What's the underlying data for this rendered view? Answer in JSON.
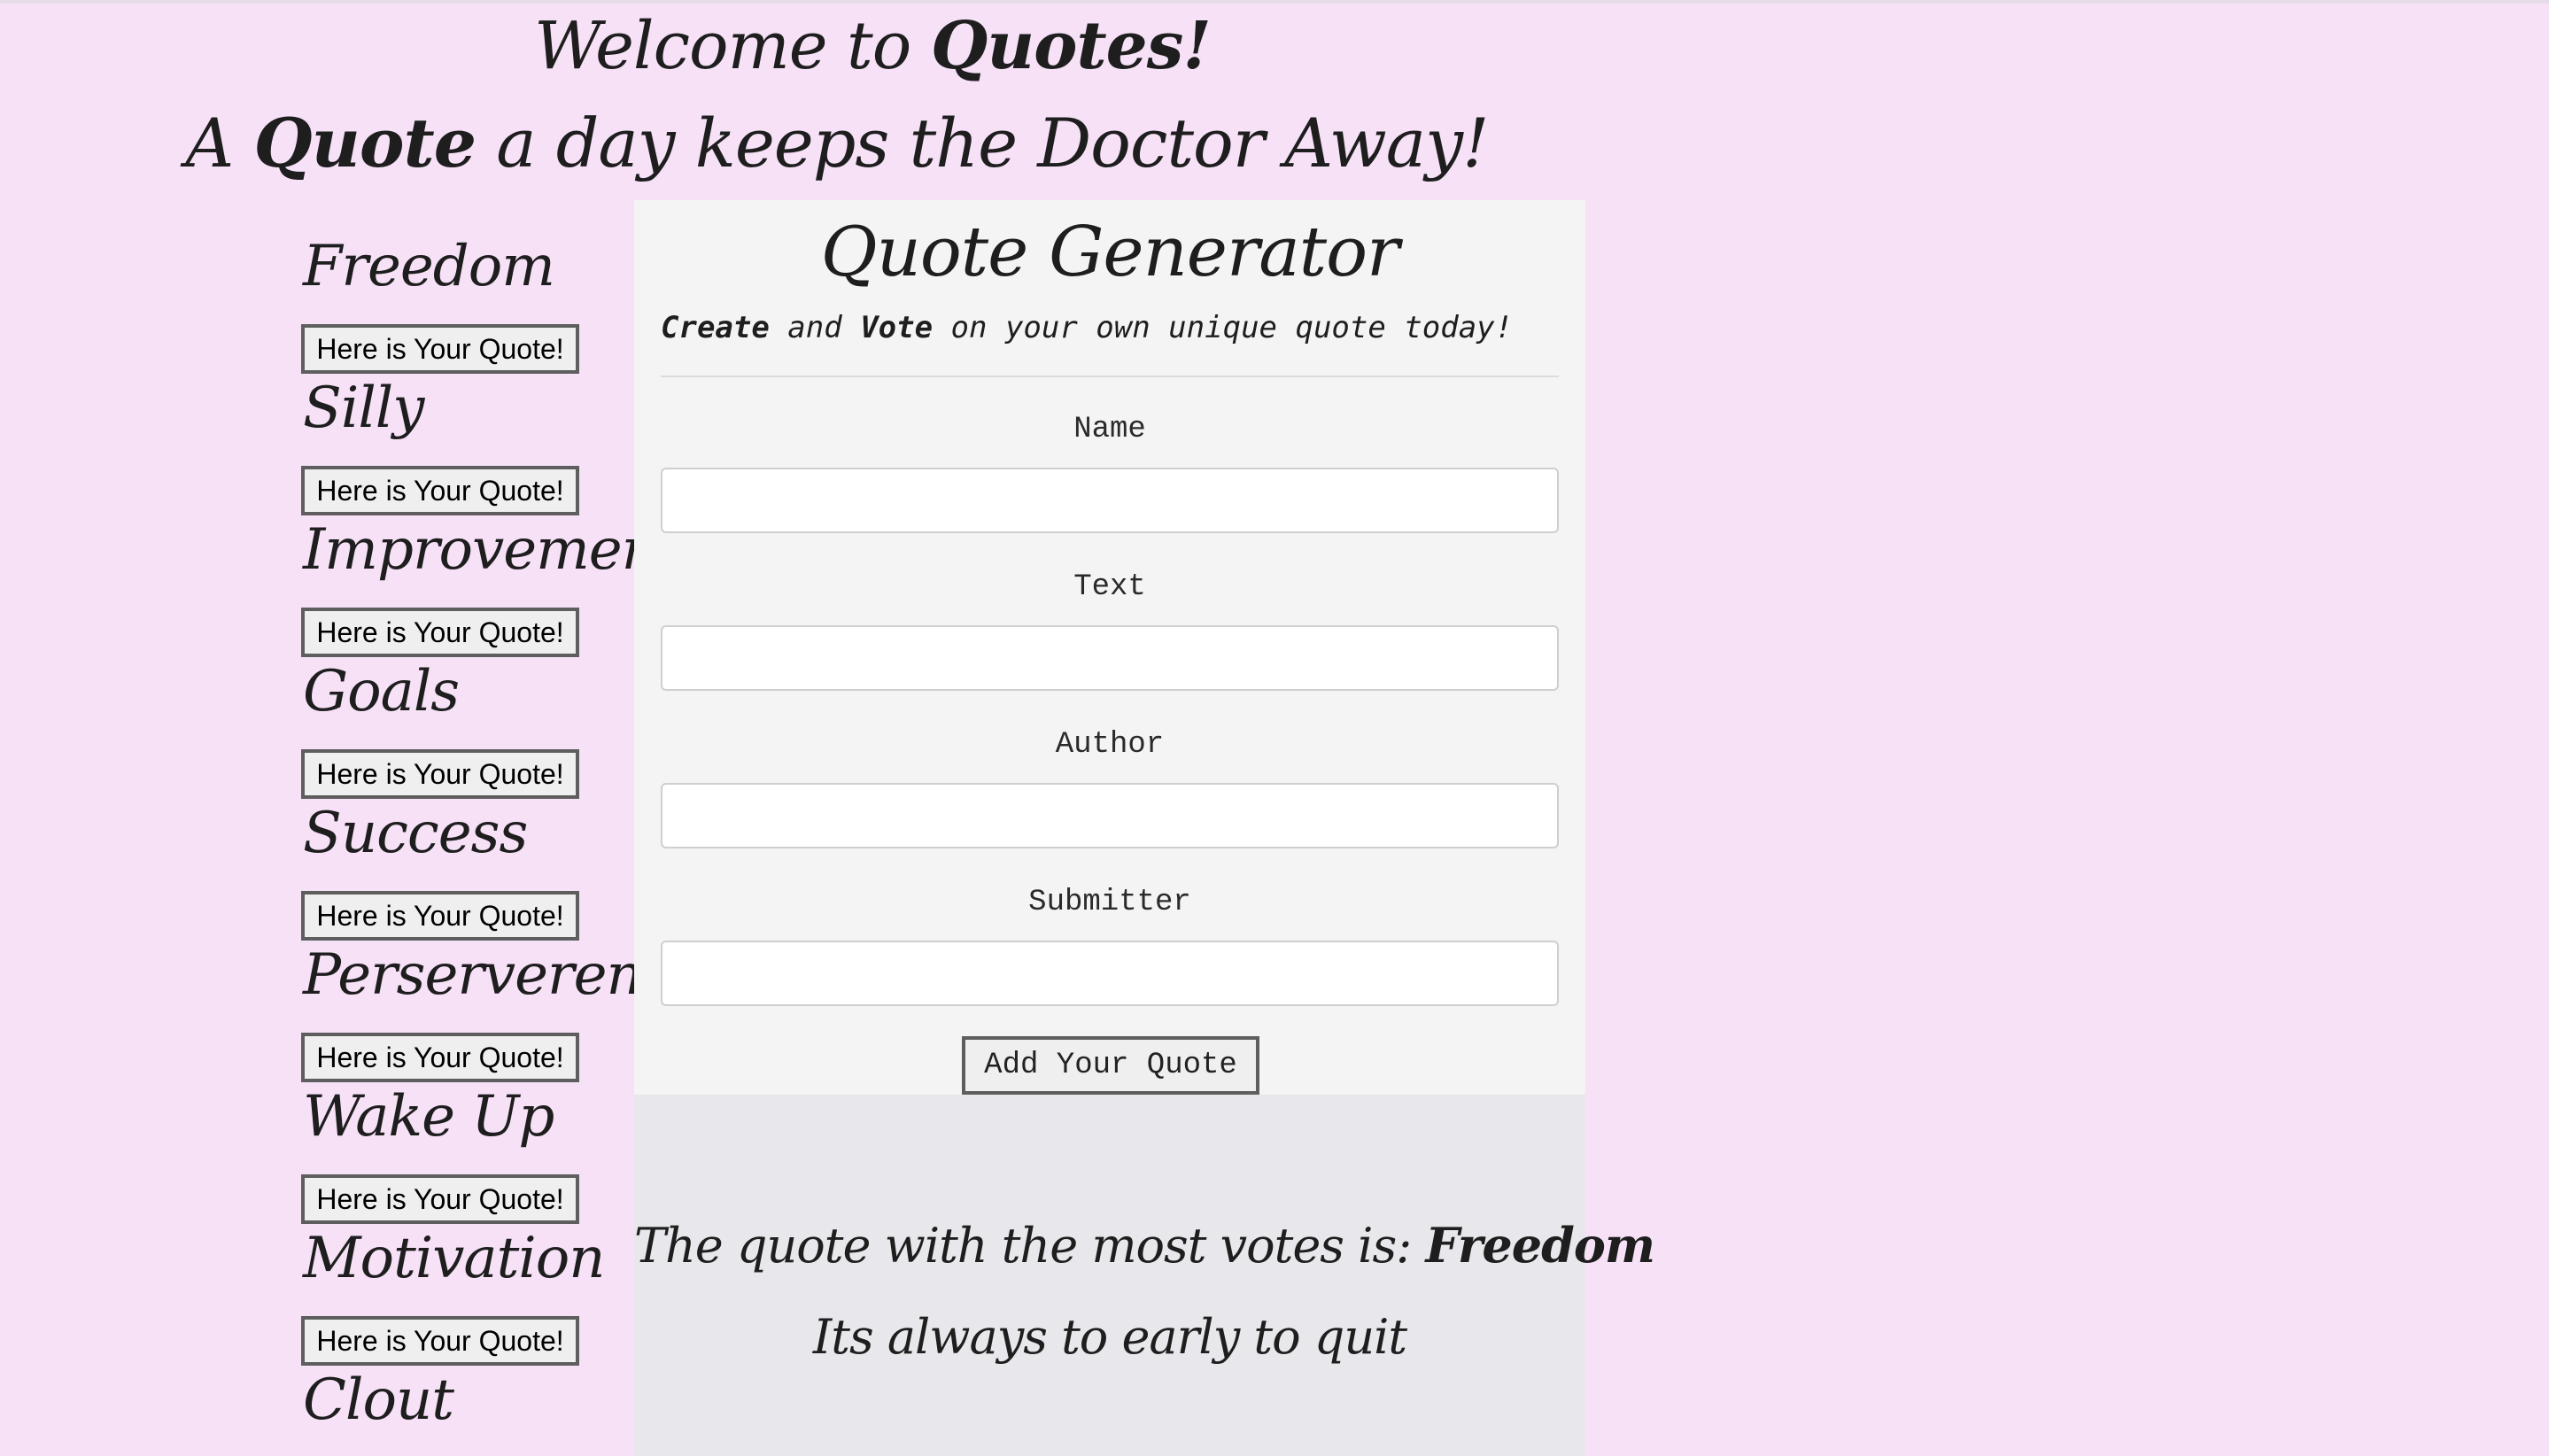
{
  "header": {
    "welcome_prefix": "Welcome to ",
    "welcome_brand": "Quotes!",
    "tagline_start": "A ",
    "tagline_brand": "Quote",
    "tagline_end": " a day keeps the Doctor Away!"
  },
  "categories": [
    {
      "name": "Freedom",
      "button": "Here is Your Quote!"
    },
    {
      "name": "Silly",
      "button": "Here is Your Quote!"
    },
    {
      "name": "Improvement",
      "button": "Here is Your Quote!"
    },
    {
      "name": "Goals",
      "button": "Here is Your Quote!"
    },
    {
      "name": "Success",
      "button": "Here is Your Quote!"
    },
    {
      "name": "Perserverence",
      "button": "Here is Your Quote!"
    },
    {
      "name": "Wake Up",
      "button": "Here is Your Quote!"
    },
    {
      "name": "Motivation",
      "button": "Here is Your Quote!"
    },
    {
      "name": "Clout",
      "button": ""
    }
  ],
  "generator": {
    "title": "Quote Generator",
    "sub_create": "Create",
    "sub_and": " and ",
    "sub_vote": "Vote",
    "sub_rest": " on your own unique quote today!",
    "fields": [
      {
        "label": "Name",
        "value": "",
        "placeholder": ""
      },
      {
        "label": "Text",
        "value": "",
        "placeholder": ""
      },
      {
        "label": "Author",
        "value": "",
        "placeholder": ""
      },
      {
        "label": "Submitter",
        "value": "",
        "placeholder": ""
      }
    ],
    "submit_label": "Add Your Quote"
  },
  "top_quote": {
    "prefix": "The quote with the most votes is: ",
    "name": "Freedom",
    "text": "Its always to early to quit"
  }
}
